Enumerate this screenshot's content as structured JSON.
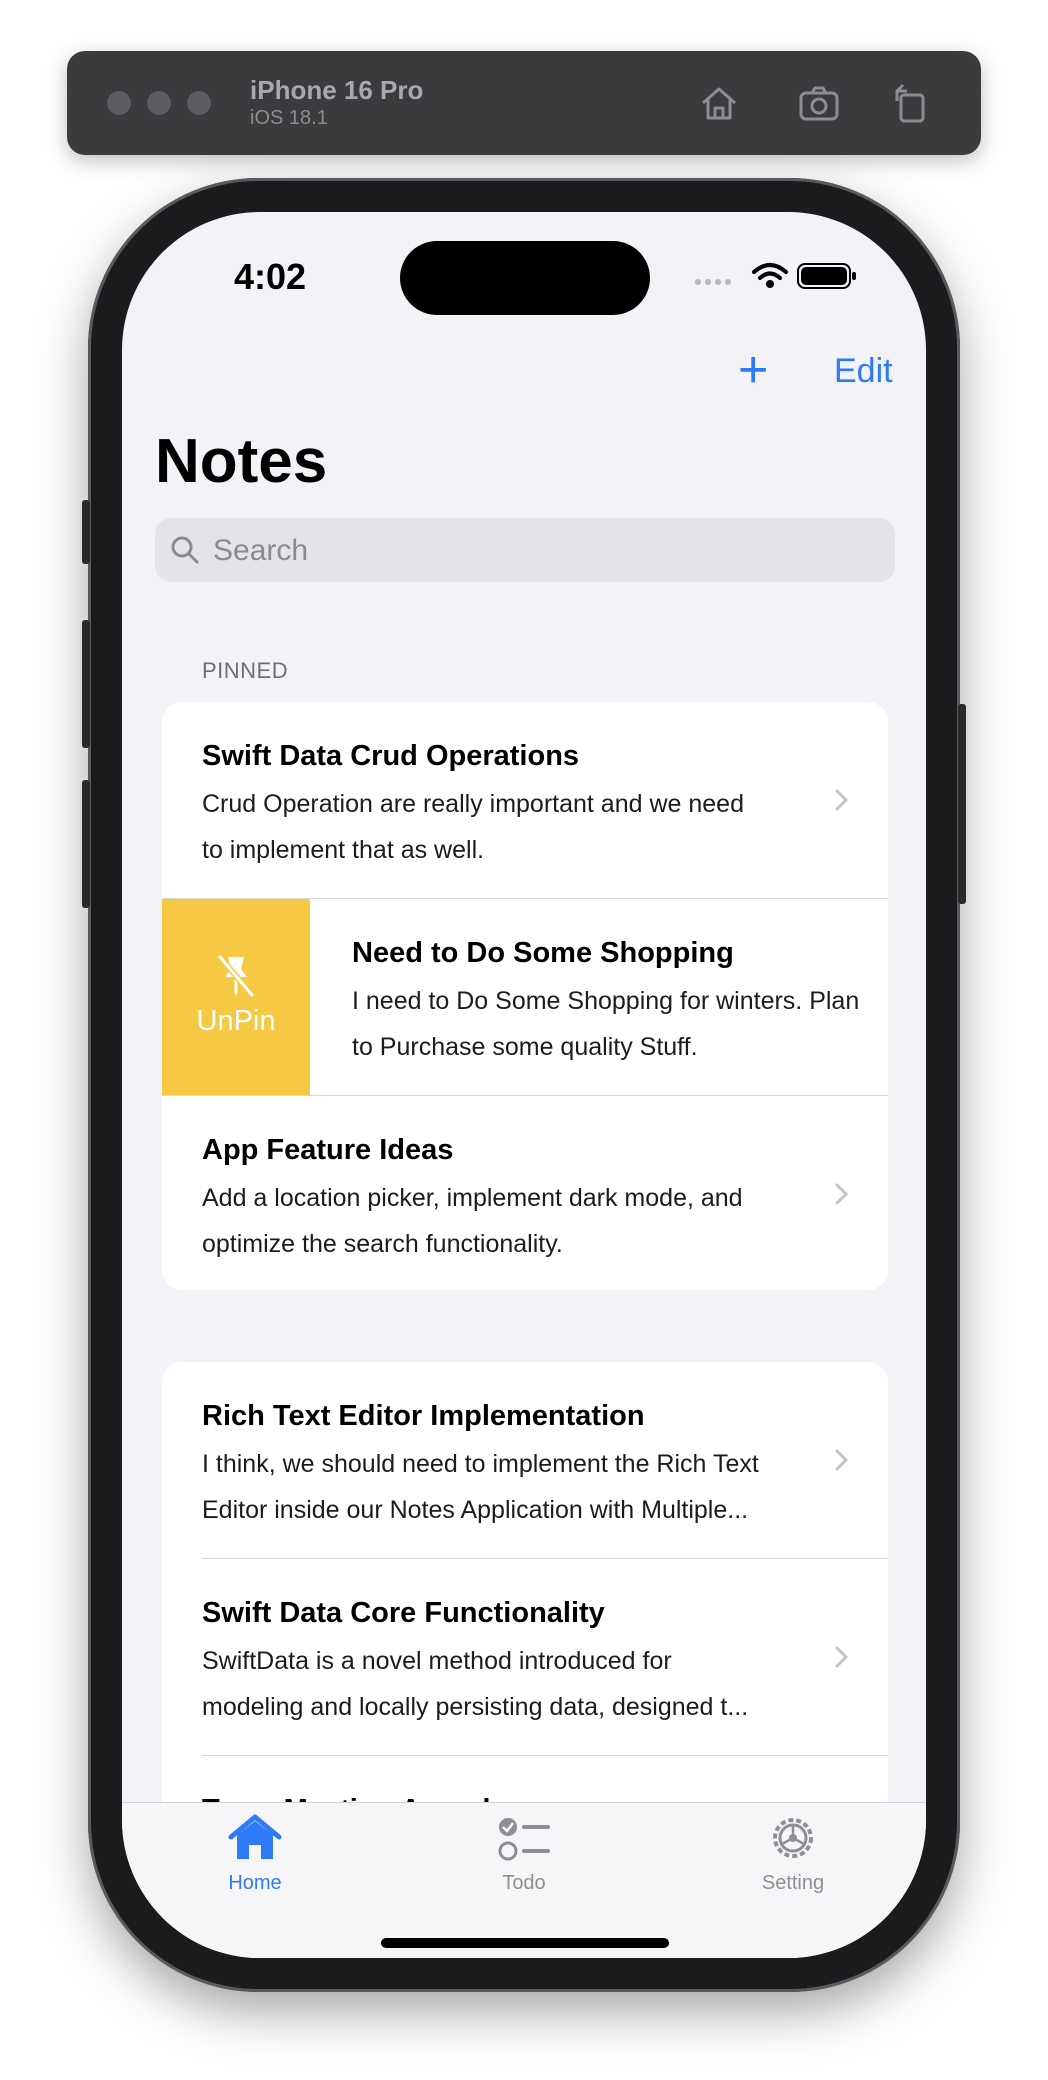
{
  "simulator": {
    "device_name": "iPhone 16 Pro",
    "os_version": "iOS 18.1",
    "icons": [
      "home-icon",
      "screenshot-icon",
      "rotate-icon"
    ]
  },
  "status_bar": {
    "time": "4:02",
    "icons": [
      "signal-icon",
      "wifi-icon",
      "battery-icon"
    ]
  },
  "nav": {
    "add_label": "+",
    "edit_label": "Edit",
    "title": "Notes"
  },
  "search": {
    "placeholder": "Search"
  },
  "pinned": {
    "header": "PINNED",
    "notes": [
      {
        "title": "Swift Data Crud Operations",
        "line1": "Crud Operation are really important and we need",
        "line2": "to implement that as well."
      },
      {
        "title": "Need to Do Some Shopping",
        "line1": "I need to Do Some Shopping for winters. Plan",
        "line2": "to Purchase some quality Stuff.",
        "swipe_action": "UnPin"
      },
      {
        "title": "App Feature Ideas",
        "line1": "Add a location picker, implement dark mode, and",
        "line2": "optimize the search functionality."
      }
    ]
  },
  "others": {
    "notes": [
      {
        "title": "Rich Text Editor Implementation",
        "line1": "I think, we should need to implement the Rich Text",
        "line2": "Editor inside our Notes Application with Multiple..."
      },
      {
        "title": "Swift Data Core Functionality",
        "line1": "SwiftData is a novel method introduced for",
        "line2": "modeling and locally persisting data, designed t..."
      },
      {
        "title": "Team Meeting Agenda",
        "line1": "",
        "line2": ""
      }
    ]
  },
  "tabbar": {
    "tabs": [
      {
        "label": "Home",
        "icon": "house-icon",
        "selected": true
      },
      {
        "label": "Todo",
        "icon": "checklist-icon",
        "selected": false
      },
      {
        "label": "Setting",
        "icon": "gear-icon",
        "selected": false
      }
    ]
  },
  "colors": {
    "accent": "#2f7bf6",
    "unpin": "#f6c945",
    "background": "#f2f2f7"
  }
}
